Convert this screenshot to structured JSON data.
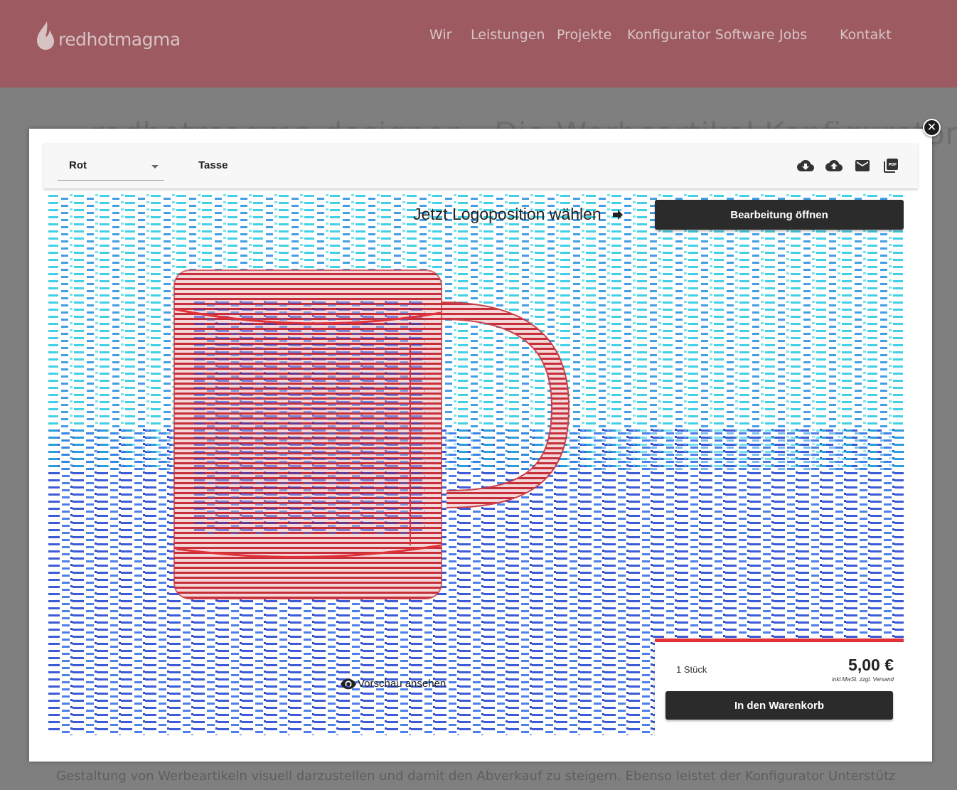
{
  "site": {
    "brand": "redhotmagma",
    "nav": [
      "Wir",
      "Leistungen",
      "Projekte",
      "Konfigurator Software",
      "Jobs",
      "Kontakt"
    ],
    "heading": "redhotmagma designer – Die Werbeartikel Konfigurator",
    "paragraph": "Gestaltung von Werbeartikeln visuell darzustellen und damit den Abverkauf zu steigern. Ebenso leistet der Konfigurator Unterstützung, die Workflows zu"
  },
  "configurator": {
    "close_icon": "close-icon",
    "color_select": {
      "value": "Rot"
    },
    "product_name": "Tasse",
    "toolbar_icons": [
      "cloud-download-icon",
      "cloud-upload-icon",
      "mail-icon",
      "pdf-icon"
    ],
    "prompt": "Jetzt Logoposition wählen",
    "edit_button": "Bearbeitung öffnen",
    "preview_link": "Vorschau ansehen",
    "pricing": {
      "quantity": "1 Stück",
      "price": "5,00 €",
      "note": "inkl.MwSt. zzgl. Versand",
      "cart_button": "In den Warenkorb"
    },
    "colors": {
      "accent_red": "#e1323a",
      "mug_red": "#c0303a",
      "button_dark": "#2b2b2b",
      "header": "#9d5a60"
    }
  }
}
